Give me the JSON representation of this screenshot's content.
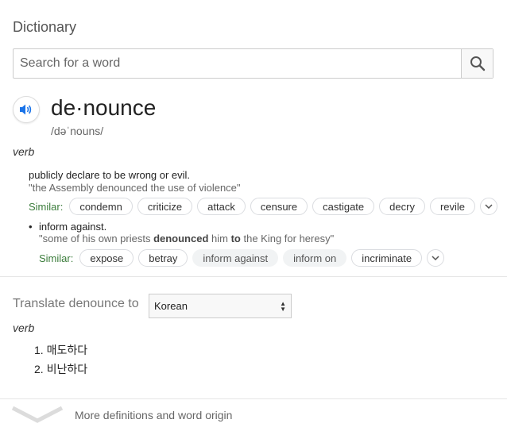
{
  "header": {
    "title": "Dictionary"
  },
  "search": {
    "placeholder": "Search for a word",
    "value": ""
  },
  "entry": {
    "word": "de·nounce",
    "phonetic": "/dəˈnouns/",
    "part_of_speech": "verb",
    "senses": [
      {
        "definition": "publicly declare to be wrong or evil.",
        "example": "\"the Assembly denounced the use of violence\"",
        "similar_label": "Similar:",
        "similar": [
          "condemn",
          "criticize",
          "attack",
          "censure",
          "castigate",
          "decry",
          "revile"
        ]
      },
      {
        "definition": "inform against.",
        "example_pre": "\"some of his own priests ",
        "example_bold": "denounced",
        "example_mid": " him ",
        "example_bold2": "to",
        "example_post": " the King for heresy\"",
        "similar_label": "Similar:",
        "similar": [
          "expose",
          "betray",
          "inform against",
          "inform on",
          "incriminate"
        ]
      }
    ]
  },
  "translate": {
    "label": "Translate denounce to",
    "language": "Korean",
    "part_of_speech": "verb",
    "items": [
      "매도하다",
      "비난하다"
    ]
  },
  "footer": {
    "more_label": "More definitions and word origin"
  },
  "colors": {
    "accent": "#1a73e8",
    "similar_label": "#3c7d3c"
  }
}
